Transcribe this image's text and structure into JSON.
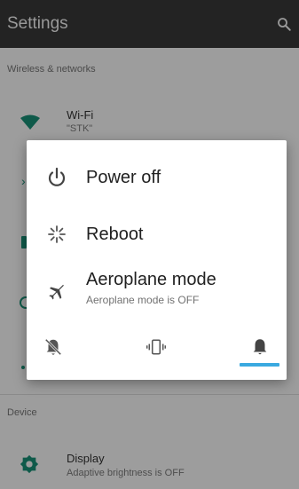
{
  "appbar": {
    "title": "Settings",
    "search_icon": "search-icon"
  },
  "background": {
    "section_wireless": "Wireless & networks",
    "wifi": {
      "title": "Wi-Fi",
      "subtitle": "\"STK\""
    },
    "section_device": "Device",
    "display": {
      "title": "Display",
      "subtitle": "Adaptive brightness is OFF"
    }
  },
  "dialog": {
    "items": [
      {
        "label": "Power off",
        "icon": "power-icon"
      },
      {
        "label": "Reboot",
        "icon": "reboot-icon"
      },
      {
        "label": "Aeroplane mode",
        "sublabel": "Aeroplane mode is OFF",
        "icon": "airplane-icon"
      }
    ],
    "sound_modes": [
      {
        "icon": "silent-bell-icon",
        "selected": false
      },
      {
        "icon": "vibrate-icon",
        "selected": false
      },
      {
        "icon": "bell-icon",
        "selected": true
      }
    ],
    "accent_color": "#3aa9e0"
  }
}
